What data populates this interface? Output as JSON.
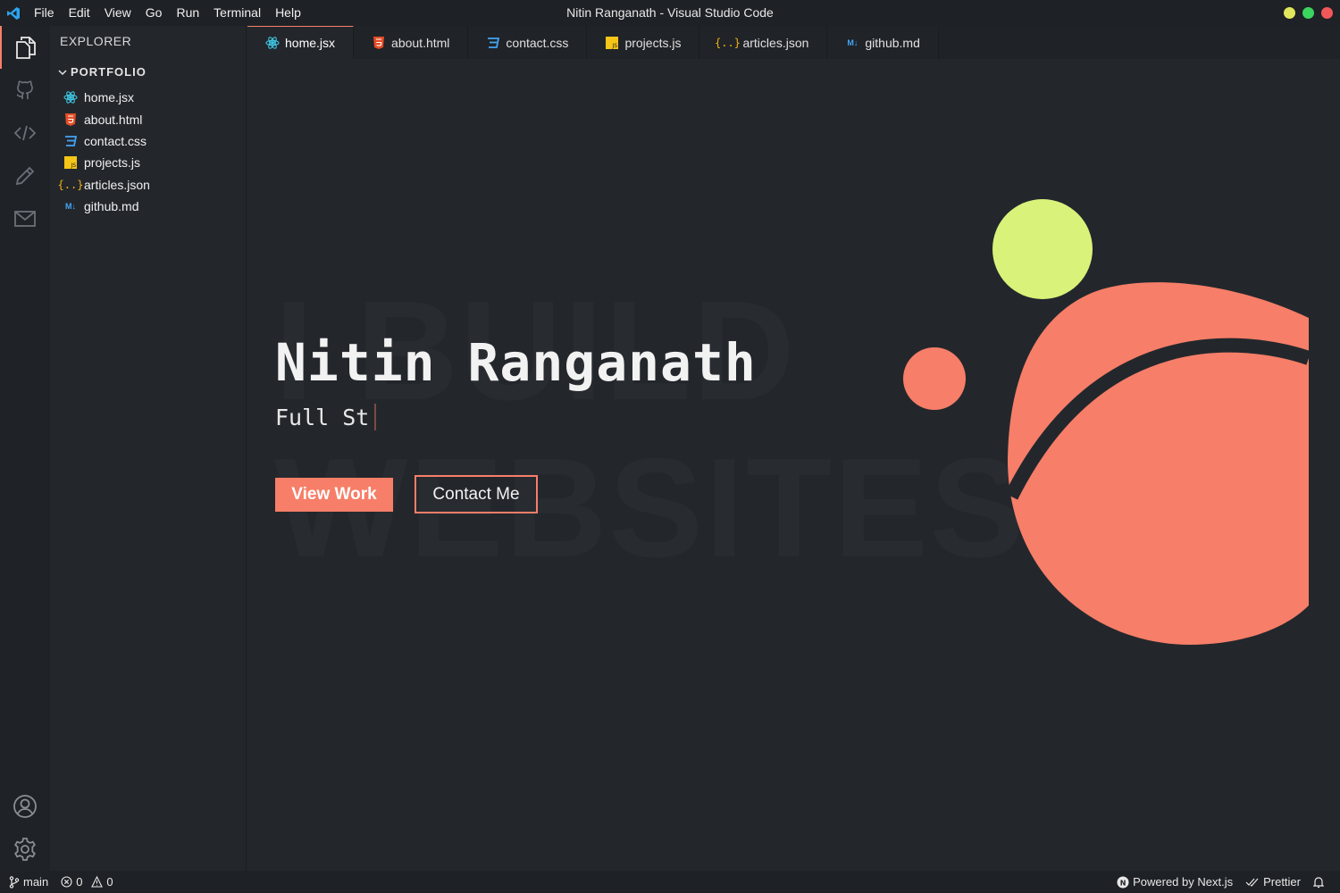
{
  "titlebar": {
    "menu": [
      "File",
      "Edit",
      "View",
      "Go",
      "Run",
      "Terminal",
      "Help"
    ],
    "title": "Nitin Ranganath - Visual Studio Code",
    "traffic_colors": [
      "#e2e65b",
      "#3ad45e",
      "#f2575a"
    ]
  },
  "activity": {
    "items": [
      "files-icon",
      "github-icon",
      "code-icon",
      "pencil-icon",
      "mail-icon"
    ],
    "bottom": [
      "account-icon",
      "settings-icon"
    ]
  },
  "sidebar": {
    "title": "EXPLORER",
    "folder": "PORTFOLIO",
    "files": [
      {
        "name": "home.jsx",
        "icon": "react-icon"
      },
      {
        "name": "about.html",
        "icon": "html-icon"
      },
      {
        "name": "contact.css",
        "icon": "css-icon"
      },
      {
        "name": "projects.js",
        "icon": "js-icon"
      },
      {
        "name": "articles.json",
        "icon": "json-icon"
      },
      {
        "name": "github.md",
        "icon": "markdown-icon"
      }
    ]
  },
  "tabs": [
    {
      "label": "home.jsx",
      "icon": "react-icon",
      "active": true
    },
    {
      "label": "about.html",
      "icon": "html-icon"
    },
    {
      "label": "contact.css",
      "icon": "css-icon"
    },
    {
      "label": "projects.js",
      "icon": "js-icon"
    },
    {
      "label": "articles.json",
      "icon": "json-icon"
    },
    {
      "label": "github.md",
      "icon": "markdown-icon"
    }
  ],
  "hero": {
    "bg_line1": "I BUILD",
    "bg_line2": "WEBSITES",
    "name": "Nitin Ranganath",
    "role": "Full St",
    "primary_button": "View Work",
    "secondary_button": "Contact Me"
  },
  "statusbar": {
    "branch": "main",
    "errors": "0",
    "warnings": "0",
    "powered": "Powered by Next.js",
    "prettier": "Prettier"
  },
  "colors": {
    "accent": "#f77e68",
    "lime": "#d9f27a",
    "bg": "#23272c"
  }
}
